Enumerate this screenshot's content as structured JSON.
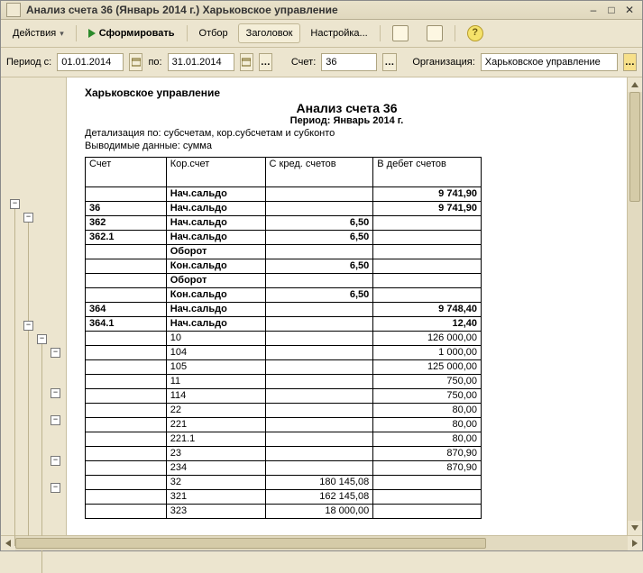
{
  "window": {
    "title": "Анализ счета 36 (Январь 2014 г.) Харьковское управление"
  },
  "toolbar": {
    "actions": "Действия",
    "form": "Сформировать",
    "filter": "Отбор",
    "header": "Заголовок",
    "settings": "Настройка..."
  },
  "filters": {
    "period_from_label": "Период с:",
    "period_from": "01.01.2014",
    "period_to_label": "по:",
    "period_to": "31.01.2014",
    "account_label": "Счет:",
    "account": "36",
    "org_label": "Организация:",
    "org": "Харьковское управление"
  },
  "report": {
    "org": "Харьковское управление",
    "title": "Анализ счета 36",
    "period": "Период: Январь 2014 г.",
    "detail": "Детализация по: субсчетам, кор.субсчетам и субконто",
    "output": "Выводимые данные: сумма",
    "columns": {
      "c1": "Счет",
      "c2": "Кор.счет",
      "c3": "С кред. счетов",
      "c4": "В дебет счетов"
    },
    "labels": {
      "open": "Нач.сальдо",
      "turn": "Оборот",
      "close": "Кон.сальдо"
    },
    "rows": [
      {
        "acct": "",
        "cor": "open",
        "c3": "",
        "c4": "9 741,90",
        "bold": true,
        "div": "top"
      },
      {
        "acct": "36",
        "cor": "open",
        "c3": "",
        "c4": "9 741,90",
        "bold": true,
        "div": "full"
      },
      {
        "acct": "362",
        "cor": "open",
        "c3": "6,50",
        "c4": "",
        "bold": true,
        "div": "full"
      },
      {
        "acct": "362.1",
        "cor": "open",
        "c3": "6,50",
        "c4": "",
        "bold": true,
        "div": "full"
      },
      {
        "acct": "",
        "cor": "turn",
        "c3": "",
        "c4": "",
        "bold": true,
        "div": "none"
      },
      {
        "acct": "",
        "cor": "close",
        "c3": "6,50",
        "c4": "",
        "bold": true,
        "div": "bot"
      },
      {
        "acct": "",
        "cor": "turn",
        "c3": "",
        "c4": "",
        "bold": true,
        "div": "none"
      },
      {
        "acct": "",
        "cor": "close",
        "c3": "6,50",
        "c4": "",
        "bold": true,
        "div": "bot"
      },
      {
        "acct": "364",
        "cor": "open",
        "c3": "",
        "c4": "9 748,40",
        "bold": true,
        "div": "full"
      },
      {
        "acct": "364.1",
        "cor": "open",
        "c3": "",
        "c4": "12,40",
        "bold": true,
        "div": "full"
      },
      {
        "acct": "",
        "cor": "10",
        "c3": "",
        "c4": "126 000,00",
        "bold": false,
        "div": "none"
      },
      {
        "acct": "",
        "cor": "104",
        "c3": "",
        "c4": "1 000,00",
        "bold": false,
        "div": "none"
      },
      {
        "acct": "",
        "cor": "105",
        "c3": "",
        "c4": "125 000,00",
        "bold": false,
        "div": "none"
      },
      {
        "acct": "",
        "cor": "11",
        "c3": "",
        "c4": "750,00",
        "bold": false,
        "div": "none"
      },
      {
        "acct": "",
        "cor": "114",
        "c3": "",
        "c4": "750,00",
        "bold": false,
        "div": "none"
      },
      {
        "acct": "",
        "cor": "22",
        "c3": "",
        "c4": "80,00",
        "bold": false,
        "div": "none"
      },
      {
        "acct": "",
        "cor": "221",
        "c3": "",
        "c4": "80,00",
        "bold": false,
        "div": "none"
      },
      {
        "acct": "",
        "cor": "221.1",
        "c3": "",
        "c4": "80,00",
        "bold": false,
        "div": "none"
      },
      {
        "acct": "",
        "cor": "23",
        "c3": "",
        "c4": "870,90",
        "bold": false,
        "div": "none"
      },
      {
        "acct": "",
        "cor": "234",
        "c3": "",
        "c4": "870,90",
        "bold": false,
        "div": "none"
      },
      {
        "acct": "",
        "cor": "32",
        "c3": "180 145,08",
        "c4": "",
        "bold": false,
        "div": "none"
      },
      {
        "acct": "",
        "cor": "321",
        "c3": "162 145,08",
        "c4": "",
        "bold": false,
        "div": "none"
      },
      {
        "acct": "",
        "cor": "323",
        "c3": "18 000,00",
        "c4": "",
        "bold": false,
        "div": "none"
      }
    ]
  }
}
